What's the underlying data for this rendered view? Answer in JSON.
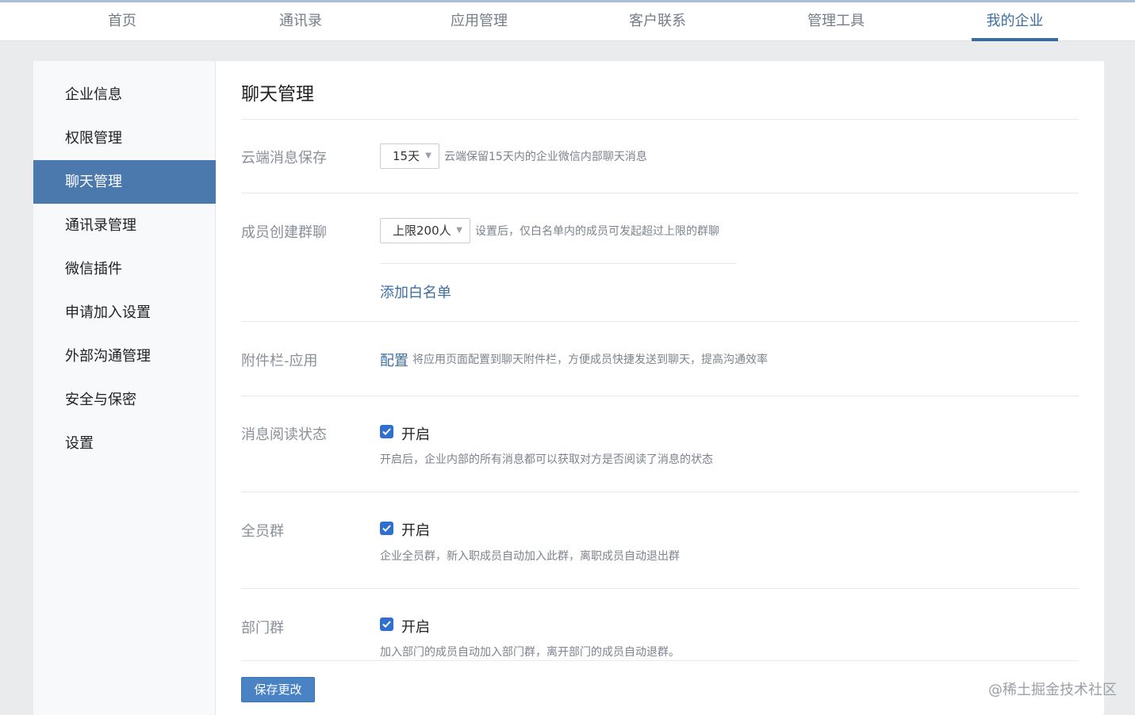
{
  "nav": {
    "items": [
      {
        "label": "首页"
      },
      {
        "label": "通讯录"
      },
      {
        "label": "应用管理"
      },
      {
        "label": "客户联系"
      },
      {
        "label": "管理工具"
      },
      {
        "label": "我的企业"
      }
    ],
    "active_index": 5
  },
  "sidebar": {
    "items": [
      {
        "label": "企业信息"
      },
      {
        "label": "权限管理"
      },
      {
        "label": "聊天管理"
      },
      {
        "label": "通讯录管理"
      },
      {
        "label": "微信插件"
      },
      {
        "label": "申请加入设置"
      },
      {
        "label": "外部沟通管理"
      },
      {
        "label": "安全与保密"
      },
      {
        "label": "设置"
      }
    ],
    "active_index": 2
  },
  "main": {
    "title": "聊天管理",
    "cloud_storage": {
      "label": "云端消息保存",
      "select_value": "15天",
      "hint": "云端保留15天内的企业微信内部聊天消息"
    },
    "member_group": {
      "label": "成员创建群聊",
      "select_value": "上限200人",
      "hint": "设置后，仅白名单内的成员可发起超过上限的群聊",
      "link": "添加白名单"
    },
    "attachment": {
      "label": "附件栏-应用",
      "link": "配置",
      "hint": "将应用页面配置到聊天附件栏，方便成员快捷发送到聊天，提高沟通效率"
    },
    "read_status": {
      "label": "消息阅读状态",
      "checkbox_label": "开启",
      "checked": true,
      "hint": "开启后，企业内部的所有消息都可以获取对方是否阅读了消息的状态"
    },
    "all_staff_group": {
      "label": "全员群",
      "checkbox_label": "开启",
      "checked": true,
      "hint": "企业全员群，新入职成员自动加入此群，离职成员自动退出群"
    },
    "dept_group": {
      "label": "部门群",
      "checkbox_label": "开启",
      "checked": true,
      "hint": "加入部门的成员自动加入部门群，离开部门的成员自动退群。"
    },
    "save_label": "保存更改"
  },
  "watermark": "@稀土掘金技术社区",
  "colors": {
    "accent": "#3f6ea2",
    "sidebar_active": "#4b79ad",
    "checkbox": "#2f6fd0",
    "save_button": "#4a83c4"
  },
  "icons": {
    "dropdown": "chevron-down-icon",
    "checkbox": "checkmark-icon"
  }
}
